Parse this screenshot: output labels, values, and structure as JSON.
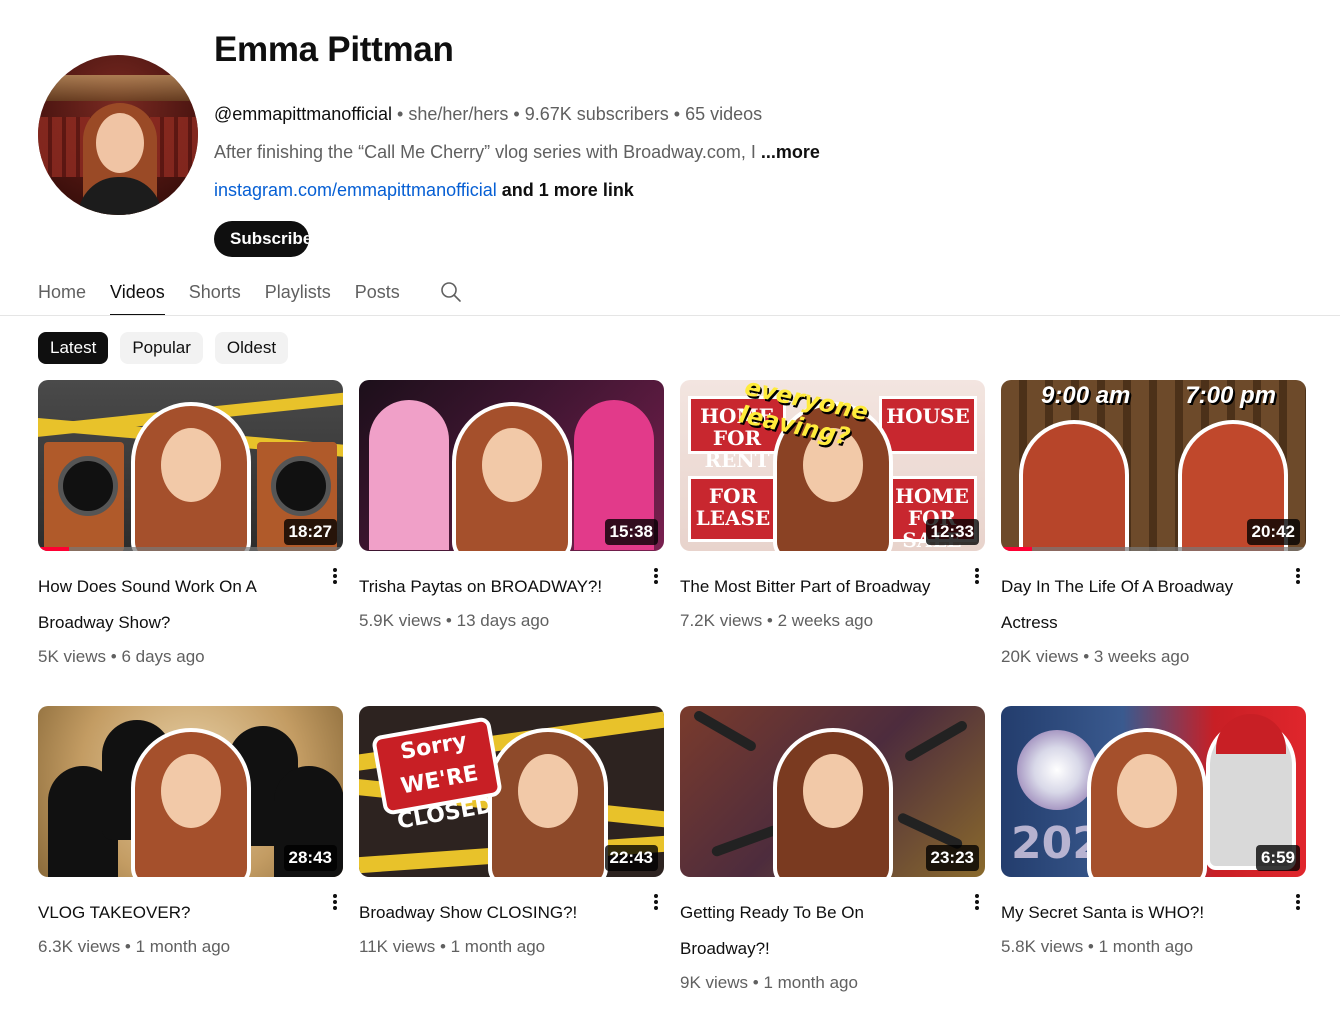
{
  "channel": {
    "name": "Emma Pittman",
    "handle": "@emmapittmanofficial",
    "pronouns": "she/her/hers",
    "subscribers": "9.67K subscribers",
    "video_count": "65 videos",
    "sep": " • ",
    "description": "After finishing the “Call Me Cherry” vlog series with Broadway.com, I ",
    "more_label": "...more",
    "link": "instagram.com/emmapittmanofficial",
    "more_links": " and 1 more link",
    "subscribe_label": "Subscribe"
  },
  "tabs": [
    {
      "label": "Home"
    },
    {
      "label": "Videos",
      "active": true
    },
    {
      "label": "Shorts"
    },
    {
      "label": "Playlists"
    },
    {
      "label": "Posts"
    }
  ],
  "search_icon": "search-icon",
  "chips": [
    {
      "label": "Latest",
      "active": true
    },
    {
      "label": "Popular"
    },
    {
      "label": "Oldest"
    }
  ],
  "colors": {
    "accent_red": "#ff0033",
    "link_blue": "#065fd4",
    "text_primary": "#0f0f0f",
    "text_secondary": "#606060"
  },
  "videos": [
    {
      "title": "How Does Sound Work On A Broadway Show?",
      "views": "5K views",
      "age": "6 days ago",
      "duration": "18:27",
      "watched_fraction": 0.1
    },
    {
      "title": "Trisha Paytas on BROADWAY?!",
      "views": "5.9K views",
      "age": "13 days ago",
      "duration": "15:38"
    },
    {
      "title": "The Most Bitter Part of Broadway",
      "views": "7.2K views",
      "age": "2 weeks ago",
      "duration": "12:33",
      "thumb_text": [
        "HOME FOR RENT",
        "HOUSE",
        "FOR LEASE",
        "HOME FOR SALE",
        "everyone leaving?"
      ]
    },
    {
      "title": "Day In The Life Of A Broadway Actress",
      "views": "20K views",
      "age": "3 weeks ago",
      "duration": "20:42",
      "watched_fraction": 0.1,
      "thumb_text": [
        "9:00 am",
        "7:00 pm"
      ]
    },
    {
      "title": "VLOG TAKEOVER?",
      "views": "6.3K views",
      "age": "1 month ago",
      "duration": "28:43"
    },
    {
      "title": "Broadway Show CLOSING?!",
      "views": "11K views",
      "age": "1 month ago",
      "duration": "22:43",
      "thumb_text": [
        "Sorry WE'RE CLOSED"
      ]
    },
    {
      "title": "Getting Ready To Be On Broadway?!",
      "views": "9K views",
      "age": "1 month ago",
      "duration": "23:23"
    },
    {
      "title": "My Secret Santa is WHO?!",
      "views": "5.8K views",
      "age": "1 month ago",
      "duration": "6:59",
      "thumb_text": [
        "2025"
      ]
    }
  ]
}
